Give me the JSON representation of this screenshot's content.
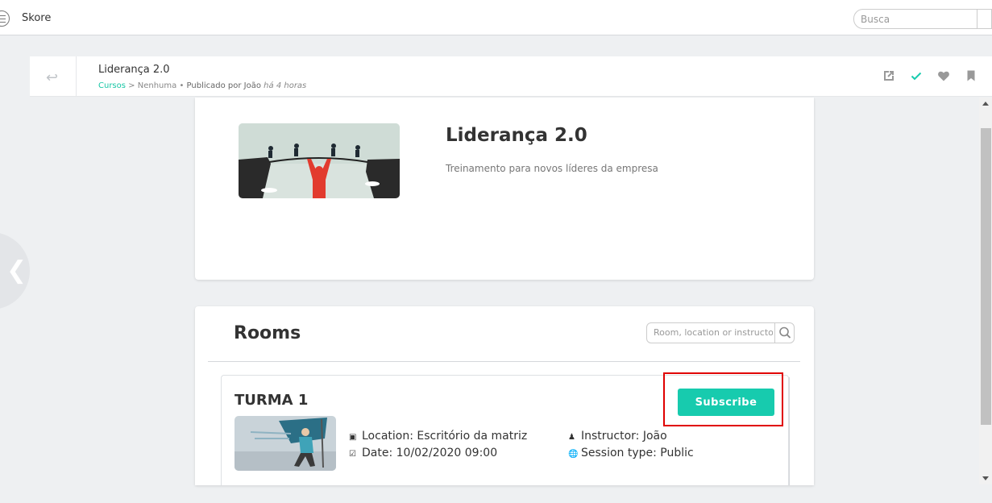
{
  "app": {
    "title": "Skore"
  },
  "search": {
    "placeholder": "Busca"
  },
  "header": {
    "title": "Liderança 2.0",
    "breadcrumb": {
      "category": "Cursos",
      "separator": ">",
      "subcategory": "Nenhuma",
      "bullet": "•",
      "published_by": "Publicado por João",
      "time": "há 4 horas"
    },
    "icons": [
      "external-link-icon",
      "check-icon",
      "heart-icon",
      "bookmark-icon"
    ]
  },
  "course": {
    "title": "Liderança 2.0",
    "description": "Treinamento para novos líderes da empresa"
  },
  "rooms": {
    "title": "Rooms",
    "search_placeholder": "Room, location or instructor",
    "items": [
      {
        "name": "TURMA 1",
        "subscribe_label": "Subscribe",
        "location": "Location: Escritório da matriz",
        "date": "Date: 10/02/2020 09:00",
        "instructor": "Instructor: João",
        "session_type": "Session type: Public"
      }
    ]
  },
  "colors": {
    "accent": "#17cbae",
    "highlight": "#e00000",
    "background": "#eef0f2"
  }
}
